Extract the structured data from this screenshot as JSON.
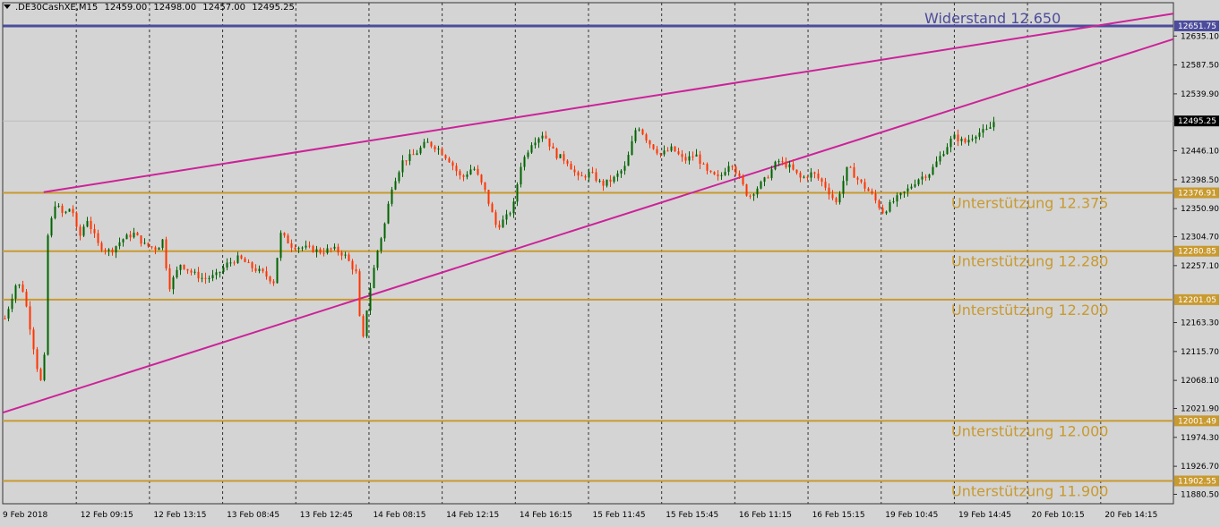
{
  "header": {
    "symbol": ".DE30CashXE,M15",
    "open": "12459.00",
    "high": "12498.00",
    "low": "12457.00",
    "close": "12495.25"
  },
  "colors": {
    "background": "#d4d4d4",
    "bull": "#006400",
    "bear": "#ff3300",
    "support": "#c89a30",
    "resistance": "#4c4c9c",
    "trendline": "#cc2299",
    "grid": "#333333",
    "axis_text": "#000000"
  },
  "chart_data": {
    "type": "candlestick",
    "title": "",
    "xlabel": "",
    "ylabel": "",
    "grid": true,
    "ylim": [
      11865,
      12690
    ],
    "y_ticks": [
      "12635.10",
      "12587.50",
      "12539.90",
      "12446.10",
      "12398.50",
      "12350.90",
      "12304.70",
      "12257.10",
      "12163.30",
      "12115.70",
      "12068.10",
      "12021.90",
      "11974.30",
      "11926.70",
      "11880.50"
    ],
    "x_labels": [
      "9 Feb 2018",
      "12 Feb 09:15",
      "12 Feb 13:15",
      "13 Feb 08:45",
      "13 Feb 12:45",
      "14 Feb 08:15",
      "14 Feb 12:15",
      "14 Feb 16:15",
      "15 Feb 11:45",
      "15 Feb 15:45",
      "16 Feb 11:15",
      "16 Feb 15:15",
      "19 Feb 10:45",
      "19 Feb 14:45",
      "20 Feb 10:15",
      "20 Feb 14:15"
    ],
    "current_price": "12495.25",
    "levels": [
      {
        "type": "resistance",
        "price": 12651.75,
        "price_label": "12651.75",
        "label": "Widerstand 12.650"
      },
      {
        "type": "support",
        "price": 12376.91,
        "price_label": "12376.91",
        "label": "Unterstützung 12.375"
      },
      {
        "type": "support",
        "price": 12280.85,
        "price_label": "12280.85",
        "label": "Unterstützung 12.280"
      },
      {
        "type": "support",
        "price": 12201.05,
        "price_label": "12201.05",
        "label": "Unterstützung 12.200"
      },
      {
        "type": "support",
        "price": 12001.49,
        "price_label": "12001.49",
        "label": "Unterstützung 12.000"
      },
      {
        "type": "support",
        "price": 11902.55,
        "price_label": "11902.55",
        "label": "Unterstützung 11.900"
      }
    ],
    "trendlines": [
      {
        "name": "upper",
        "points": [
          [
            0.035,
            12378
          ],
          [
            1.0,
            12672
          ]
        ]
      },
      {
        "name": "lower",
        "points": [
          [
            0.0,
            12015
          ],
          [
            1.0,
            12630
          ]
        ]
      }
    ],
    "price_path": [
      [
        0.0,
        12170
      ],
      [
        0.01,
        12230
      ],
      [
        0.016,
        12215
      ],
      [
        0.022,
        12150
      ],
      [
        0.028,
        12085
      ],
      [
        0.033,
        12050
      ],
      [
        0.036,
        12300
      ],
      [
        0.043,
        12360
      ],
      [
        0.05,
        12340
      ],
      [
        0.057,
        12355
      ],
      [
        0.063,
        12300
      ],
      [
        0.07,
        12335
      ],
      [
        0.08,
        12290
      ],
      [
        0.09,
        12280
      ],
      [
        0.1,
        12300
      ],
      [
        0.11,
        12310
      ],
      [
        0.12,
        12290
      ],
      [
        0.13,
        12285
      ],
      [
        0.135,
        12300
      ],
      [
        0.14,
        12220
      ],
      [
        0.15,
        12260
      ],
      [
        0.16,
        12245
      ],
      [
        0.17,
        12235
      ],
      [
        0.18,
        12240
      ],
      [
        0.19,
        12260
      ],
      [
        0.2,
        12270
      ],
      [
        0.21,
        12255
      ],
      [
        0.22,
        12245
      ],
      [
        0.23,
        12230
      ],
      [
        0.235,
        12310
      ],
      [
        0.245,
        12290
      ],
      [
        0.26,
        12285
      ],
      [
        0.27,
        12280
      ],
      [
        0.28,
        12285
      ],
      [
        0.29,
        12275
      ],
      [
        0.3,
        12245
      ],
      [
        0.305,
        12120
      ],
      [
        0.31,
        12200
      ],
      [
        0.318,
        12280
      ],
      [
        0.325,
        12330
      ],
      [
        0.33,
        12385
      ],
      [
        0.34,
        12430
      ],
      [
        0.35,
        12440
      ],
      [
        0.36,
        12460
      ],
      [
        0.37,
        12450
      ],
      [
        0.38,
        12430
      ],
      [
        0.39,
        12400
      ],
      [
        0.4,
        12420
      ],
      [
        0.41,
        12380
      ],
      [
        0.42,
        12320
      ],
      [
        0.43,
        12340
      ],
      [
        0.435,
        12360
      ],
      [
        0.44,
        12420
      ],
      [
        0.45,
        12460
      ],
      [
        0.46,
        12475
      ],
      [
        0.47,
        12440
      ],
      [
        0.48,
        12430
      ],
      [
        0.49,
        12400
      ],
      [
        0.5,
        12410
      ],
      [
        0.51,
        12390
      ],
      [
        0.52,
        12400
      ],
      [
        0.53,
        12420
      ],
      [
        0.54,
        12490
      ],
      [
        0.55,
        12460
      ],
      [
        0.56,
        12440
      ],
      [
        0.57,
        12450
      ],
      [
        0.58,
        12430
      ],
      [
        0.59,
        12440
      ],
      [
        0.6,
        12410
      ],
      [
        0.61,
        12400
      ],
      [
        0.62,
        12430
      ],
      [
        0.63,
        12390
      ],
      [
        0.635,
        12370
      ],
      [
        0.64,
        12380
      ],
      [
        0.65,
        12400
      ],
      [
        0.66,
        12430
      ],
      [
        0.67,
        12420
      ],
      [
        0.68,
        12400
      ],
      [
        0.69,
        12410
      ],
      [
        0.7,
        12390
      ],
      [
        0.71,
        12360
      ],
      [
        0.72,
        12420
      ],
      [
        0.73,
        12395
      ],
      [
        0.74,
        12375
      ],
      [
        0.75,
        12345
      ],
      [
        0.76,
        12365
      ],
      [
        0.77,
        12380
      ],
      [
        0.78,
        12400
      ],
      [
        0.79,
        12410
      ],
      [
        0.8,
        12440
      ],
      [
        0.81,
        12470
      ],
      [
        0.82,
        12460
      ],
      [
        0.83,
        12475
      ],
      [
        0.84,
        12480
      ],
      [
        0.845,
        12495
      ]
    ]
  }
}
